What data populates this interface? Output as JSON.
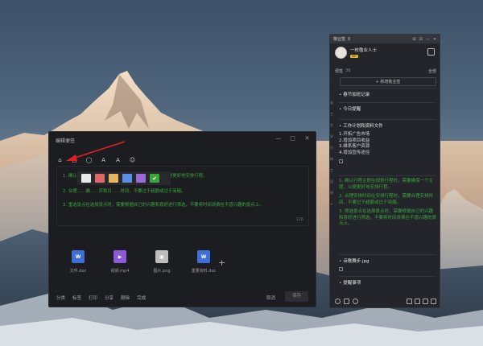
{
  "editor": {
    "title": "编辑便签",
    "window_buttons": [
      "—",
      "□",
      "✕"
    ],
    "toolbar_icons": [
      "bell-icon",
      "text-color-icon",
      "search-icon",
      "font-larger-icon",
      "font-smaller-icon",
      "emoji-icon"
    ],
    "toolbar_glyphs": [
      "⌂",
      "△",
      "◯",
      "A",
      "A",
      "☺"
    ],
    "note_lines": [
      "1. 确认日程主题在规划行程时，需要确保一个主题，以便更好地安排行程。",
      "2. 合理……确……序和日……时间，不要过于超额或过于简缩。",
      "3. 重选景点在选择景点时，需要根据自己的兴趣和喜好进行筛选，不要将时间浪费在不感兴趣的景点上。"
    ],
    "char_count": "126",
    "palette": [
      "#e9e9e9",
      "#e06767",
      "#e6b760",
      "#5a8fe8",
      "#9a68d8",
      "#3aa63a"
    ],
    "palette_check": "✔",
    "attachments": [
      {
        "name": "文件.doc",
        "icon": "word-doc-icon",
        "glyph": "W",
        "color": "#3f6fd6"
      },
      {
        "name": "视频.mp4",
        "icon": "video-icon",
        "glyph": "▶",
        "color": "#8a5ad8"
      },
      {
        "name": "图片.png",
        "icon": "image-icon",
        "glyph": "▣",
        "color": "#bdbdbd"
      },
      {
        "name": "重要资料.doc",
        "icon": "word-doc-icon",
        "glyph": "W",
        "color": "#3f6fd6"
      }
    ],
    "add_glyph": "+",
    "bottom_actions": [
      "分类",
      "标签",
      "打印",
      "分享",
      "删除",
      "完成"
    ],
    "cancel": "取消",
    "save": "保存"
  },
  "panel": {
    "header_title": "敬业签",
    "header_count": "0",
    "header_icons": [
      "⊞",
      "⊟",
      "—",
      "✕"
    ],
    "user_name": "一枚敬业人士",
    "vip": "VIP",
    "section_label": "便签",
    "section_count": "36",
    "sort_label": "全部",
    "new_note": "+ 新增敬业签",
    "sidebar_tabs": [
      "全",
      "工",
      "生",
      "学",
      "日",
      "待",
      "工",
      "设",
      "进",
      "+"
    ],
    "notes": [
      {
        "title": "春节加班记录",
        "lines": [],
        "green": []
      },
      {
        "title": "今日提醒",
        "lines": [],
        "green": []
      },
      {
        "title": "工作计划和资料文件",
        "lines": [
          "1.开拓广告市场",
          "2.增加项目收益",
          "3.维系客户资源",
          "4.增加宣传途径"
        ],
        "green": []
      },
      {
        "title": "",
        "lines": [],
        "green": [
          "1. 确认行程主题在规划行程时，需要确保一个主题，以便更好地安排行程。",
          "2. 合理安排时间在安排行程时，需要合理安排时间，不要过于超额或过于简缩。",
          "3. 筛选景点在选择景点时，需要根据自己的兴趣和喜好进行筛选，不要将时间浪费在不感兴趣的景点上。"
        ]
      },
      {
        "title": "诗歌舞步.jpg",
        "lines": [],
        "green": []
      },
      {
        "title": "提醒事项",
        "lines": [],
        "green": []
      }
    ]
  }
}
